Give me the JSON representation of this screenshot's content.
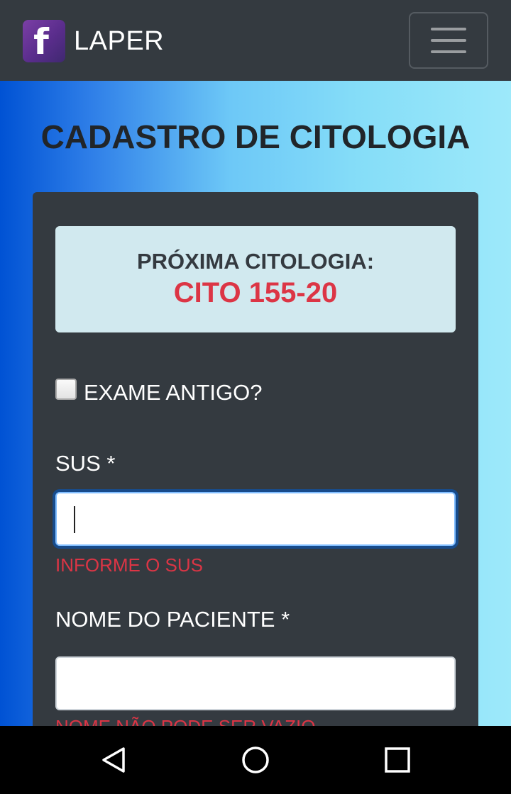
{
  "navbar": {
    "brand_letter": "f",
    "brand_name": "LAPER"
  },
  "page": {
    "title": "CADASTRO DE CITOLOGIA"
  },
  "alert": {
    "label": "PRÓXIMA CITOLOGIA:",
    "value": "CITO 155-20"
  },
  "form": {
    "old_exam_label": "EXAME ANTIGO?",
    "old_exam_checked": false,
    "sus": {
      "label": "SUS *",
      "value": "",
      "error": "INFORME O SUS"
    },
    "patient_name": {
      "label": "NOME DO PACIENTE *",
      "value": "",
      "error": "NOME NÃO PODE SER VAZIO"
    }
  },
  "colors": {
    "navbar": "#343a40",
    "card": "#343a40",
    "alert_bg": "#d1e9ef",
    "danger": "#dc3545",
    "gradient_start": "#0052d4",
    "gradient_end": "#9de9fa"
  },
  "system_nav": {
    "icons": [
      "back-icon",
      "home-icon",
      "recents-icon"
    ]
  }
}
